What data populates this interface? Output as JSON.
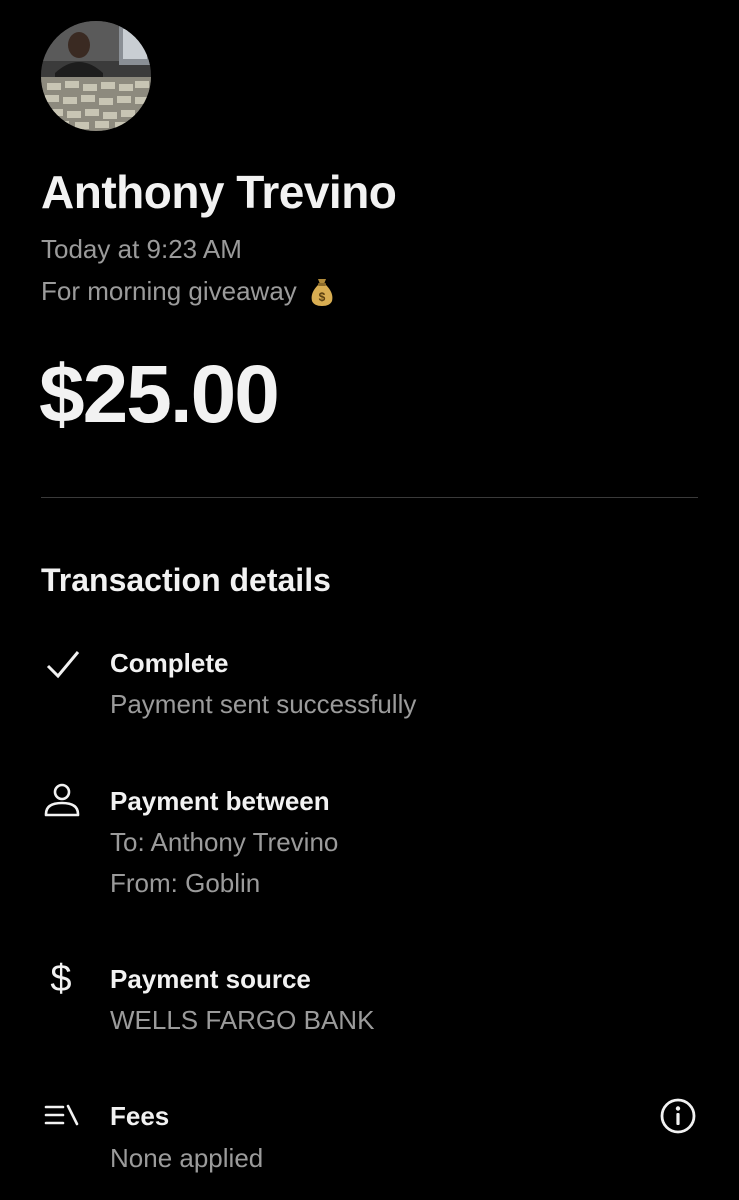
{
  "recipient": {
    "name": "Anthony Trevino",
    "avatar_icon": "profile-photo"
  },
  "payment": {
    "time": "Today at 9:23 AM",
    "note": "For morning giveaway",
    "note_emoji": "money-bag-icon",
    "amount": "$25.00"
  },
  "details": {
    "title": "Transaction details",
    "status": {
      "icon": "checkmark-icon",
      "title": "Complete",
      "subtitle": "Payment sent successfully"
    },
    "between": {
      "icon": "person-icon",
      "title": "Payment between",
      "to": "To: Anthony Trevino",
      "from": "From: Goblin"
    },
    "source": {
      "icon": "dollar-icon",
      "title": "Payment source",
      "value": "WELLS FARGO BANK"
    },
    "fees": {
      "icon": "fees-list-icon",
      "title": "Fees",
      "value": "None applied",
      "info_icon": "info-icon"
    }
  },
  "colors": {
    "background": "#000000",
    "primary_text": "#f2f2f2",
    "secondary_text": "#9b9b9b",
    "divider": "#3a3a3a"
  }
}
